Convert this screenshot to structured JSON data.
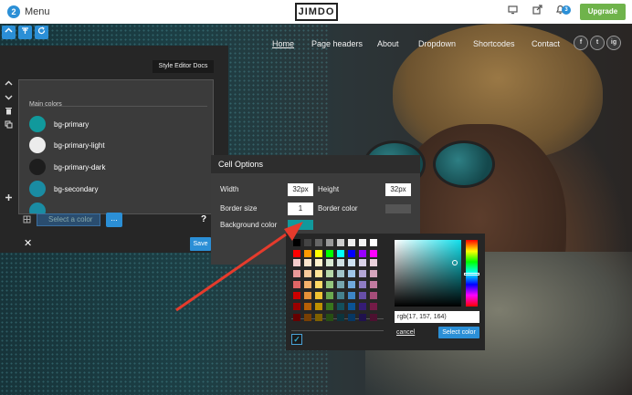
{
  "topbar": {
    "menu_count": "2",
    "menu_label": "Menu",
    "logo": "JIMDO",
    "icons": [
      "monitor-icon",
      "share-icon",
      "bell-icon"
    ],
    "notifications_count": "3",
    "upgrade_label": "Upgrade"
  },
  "site_nav": {
    "items": [
      "Home",
      "Page headers",
      "About",
      "Dropdown",
      "Shortcodes",
      "Contact"
    ],
    "active": "Home",
    "social": [
      "f",
      "t",
      "ig"
    ]
  },
  "style_editor": {
    "docs_label": "Style Editor Docs",
    "section_title": "Main colors",
    "colors": [
      {
        "name": "bg-primary",
        "color": "#11999c"
      },
      {
        "name": "bg-primary-light",
        "color": "#ececec"
      },
      {
        "name": "bg-primary-dark",
        "color": "#1d1d1d"
      },
      {
        "name": "bg-secondary",
        "color": "#1a8ca3"
      }
    ],
    "select_placeholder": "Select a color",
    "dots_label": "...",
    "help_label": "?",
    "save_label": "Save",
    "close_label": "✕"
  },
  "cell_options": {
    "title": "Cell Options",
    "width_label": "Width",
    "width_value": "32px",
    "height_label": "Height",
    "height_value": "32px",
    "border_size_label": "Border size",
    "border_size_value": "1",
    "border_color_label": "Border color",
    "border_color": "#555555",
    "background_color_label": "Background color",
    "background_color": "#11999c"
  },
  "color_picker": {
    "palette": [
      [
        "#000000",
        "#444444",
        "#666666",
        "#999999",
        "#cccccc",
        "#eeeeee",
        "#f3f3f3",
        "#ffffff"
      ],
      [
        "#ff0000",
        "#ff9900",
        "#ffff00",
        "#00ff00",
        "#00ffff",
        "#0000ff",
        "#9900ff",
        "#ff00ff"
      ],
      [
        "#f4cccc",
        "#fce5cd",
        "#fff2cc",
        "#d9ead3",
        "#d0e0e3",
        "#cfe2f3",
        "#d9d2e9",
        "#ead1dc"
      ],
      [
        "#ea9999",
        "#f9cb9c",
        "#ffe599",
        "#b6d7a8",
        "#a2c4c9",
        "#9fc5e8",
        "#b4a7d6",
        "#d5a6bd"
      ],
      [
        "#e06666",
        "#f6b26b",
        "#ffd966",
        "#93c47d",
        "#76a5af",
        "#6fa8dc",
        "#8e7cc3",
        "#c27ba0"
      ],
      [
        "#cc0000",
        "#e69138",
        "#f1c232",
        "#6aa84f",
        "#45818e",
        "#3d85c6",
        "#674ea7",
        "#a64d79"
      ],
      [
        "#990000",
        "#b45f06",
        "#bf9000",
        "#38761d",
        "#134f5c",
        "#0b5394",
        "#351c75",
        "#741b47"
      ],
      [
        "#660000",
        "#783f04",
        "#7f6000",
        "#274e13",
        "#0c343d",
        "#073763",
        "#20124d",
        "#4c1130"
      ]
    ],
    "rgb_value": "rgb(17, 157, 164)",
    "cancel_label": "cancel",
    "select_label": "Select color",
    "checkbox_checked": true
  },
  "annotation": {
    "color": "#e53b2c"
  }
}
